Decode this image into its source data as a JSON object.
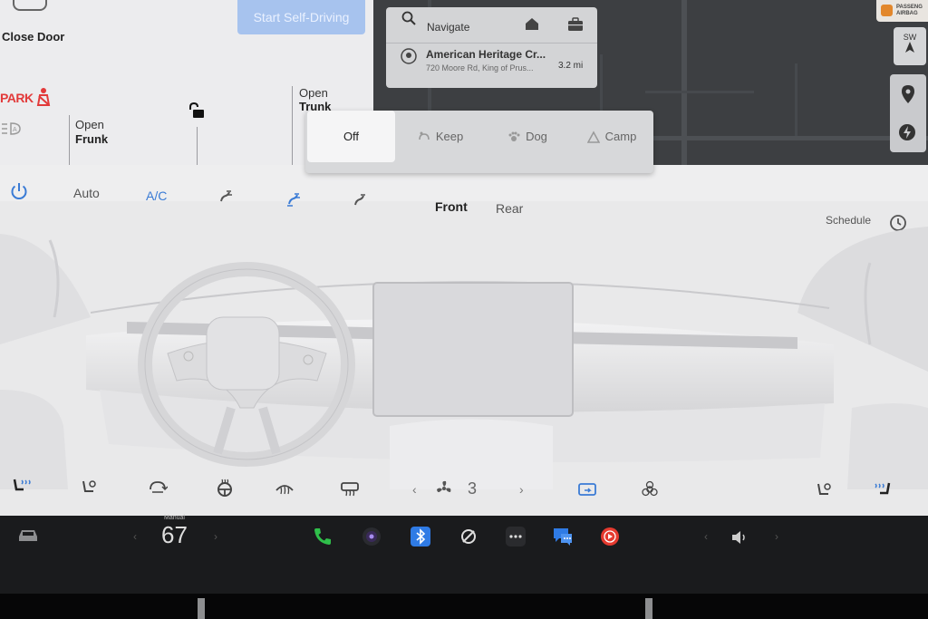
{
  "car": {
    "close_door": "Close Door",
    "start_self_driving": "Start Self-Driving",
    "park_indicator": "PARK",
    "frunk_action": "Open",
    "frunk_label": "Frunk",
    "trunk_action": "Open",
    "trunk_label": "Trunk"
  },
  "map": {
    "navigate_label": "Navigate",
    "destination_name": "American Heritage Cr...",
    "destination_address": "720 Moore Rd, King of Prus...",
    "destination_distance": "3.2 mi",
    "compass_heading": "SW",
    "airbag_line1": "PASSENG",
    "airbag_line2": "AIRBAG"
  },
  "mode_popup": {
    "options": [
      {
        "label": "Off",
        "icon": "off",
        "selected": true
      },
      {
        "label": "Keep",
        "icon": "keep-icon",
        "selected": false
      },
      {
        "label": "Dog",
        "icon": "paw-icon",
        "selected": false
      },
      {
        "label": "Camp",
        "icon": "tent-icon",
        "selected": false
      }
    ]
  },
  "climate": {
    "auto_label": "Auto",
    "ac_label": "A/C",
    "front_label": "Front",
    "rear_label": "Rear",
    "schedule_label": "Schedule",
    "fan_speed": "3",
    "accent_color": "#3a7bd5"
  },
  "dock": {
    "temp_mode": "Manual",
    "temperature": "67",
    "icons": [
      "car-icon",
      "phone-icon",
      "camera-icon",
      "bluetooth-icon",
      "streaming-icon",
      "more-apps-icon",
      "messages-icon",
      "music-icon",
      "volume-icon"
    ]
  }
}
